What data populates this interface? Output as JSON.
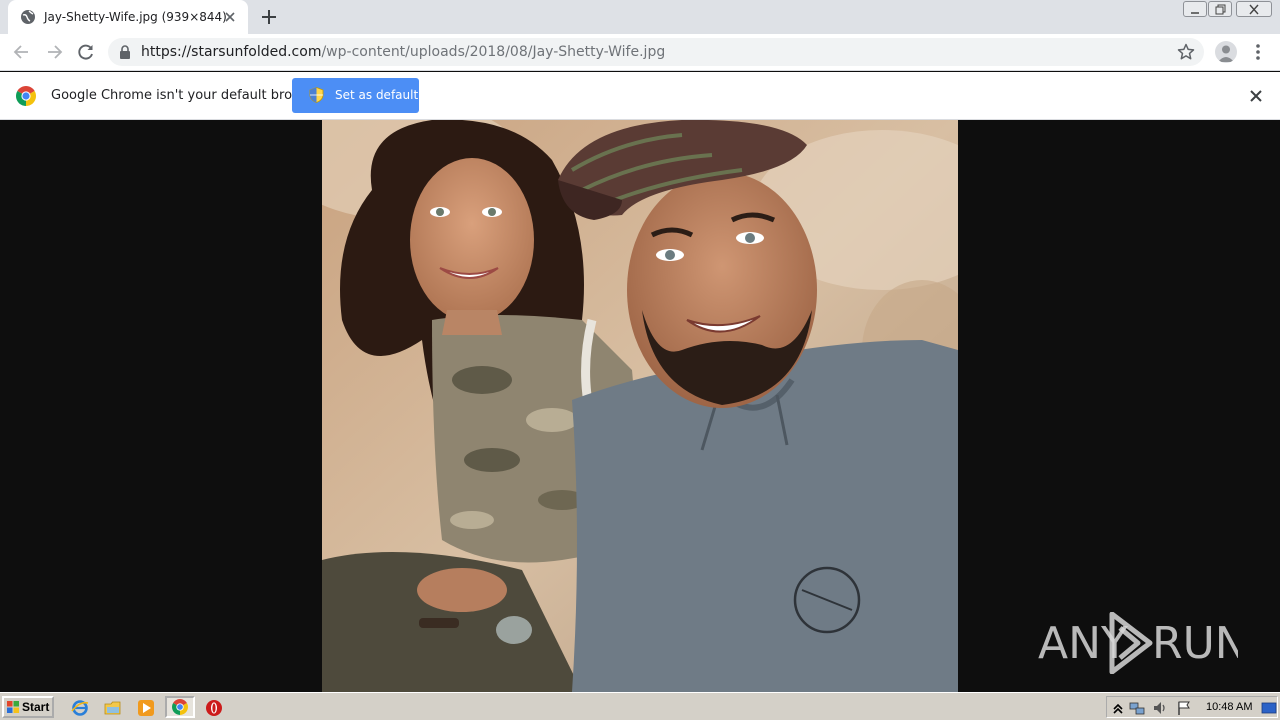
{
  "browser": {
    "tab": {
      "title": "Jay-Shetty-Wife.jpg (939×844)",
      "favicon": "globe-icon",
      "close_icon": "close-icon"
    },
    "new_tab_icon": "plus-icon",
    "window_controls": [
      "minimize-icon",
      "restore-icon",
      "close-icon"
    ]
  },
  "toolbar": {
    "back_icon": "arrow-left-icon",
    "forward_icon": "arrow-right-icon",
    "reload_icon": "reload-icon",
    "url_host": "https://starsunfolded.com",
    "url_path": "/wp-content/uploads/2018/08/Jay-Shetty-Wife.jpg",
    "secure_icon": "lock-icon",
    "bookmark_icon": "star-icon",
    "profile_icon": "avatar-icon",
    "menu_icon": "kebab-menu-icon"
  },
  "infobar": {
    "message": "Google Chrome isn't your default browser",
    "button_label": "Set as default",
    "button_color": "#4c8ef5"
  },
  "content": {
    "image_subject": "photo-woman-and-man-smiling",
    "background_color": "#0e0e0e",
    "watermark_text": "ANY",
    "watermark_text_2": "RUN"
  },
  "taskbar": {
    "start_label": "Start",
    "apps": [
      "internet-explorer-icon",
      "folder-icon",
      "media-player-icon",
      "chrome-icon",
      "opera-icon"
    ],
    "tray_icons": [
      "show-hidden-icon",
      "network-icon",
      "volume-icon",
      "flag-icon"
    ],
    "clock": "10:48 AM"
  }
}
